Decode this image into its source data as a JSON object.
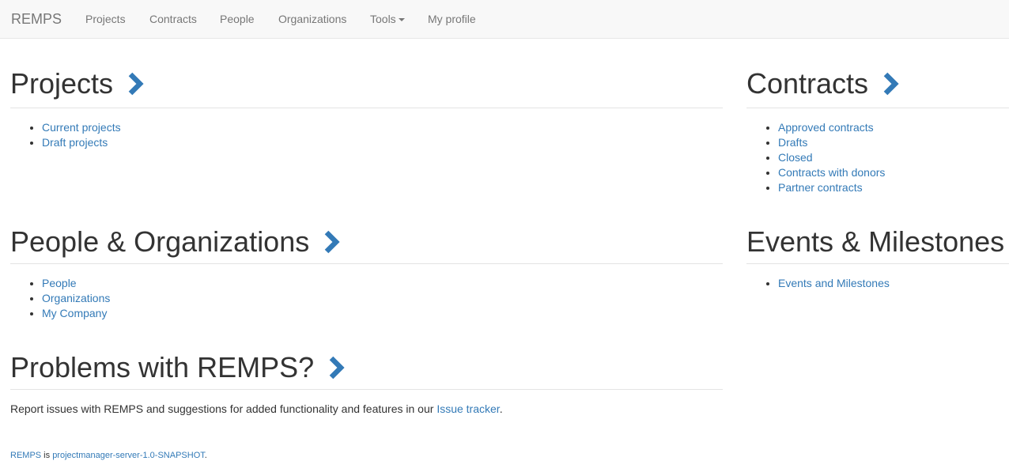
{
  "navbar": {
    "brand": "REMPS",
    "items": [
      {
        "label": "Projects"
      },
      {
        "label": "Contracts"
      },
      {
        "label": "People"
      },
      {
        "label": "Organizations"
      },
      {
        "label": "Tools"
      },
      {
        "label": "My profile"
      }
    ]
  },
  "projects": {
    "title": "Projects",
    "links": [
      "Current projects",
      "Draft projects"
    ]
  },
  "contracts": {
    "title": "Contracts",
    "links": [
      "Approved contracts",
      "Drafts",
      "Closed",
      "Contracts with donors",
      "Partner contracts"
    ]
  },
  "people_orgs": {
    "title": "People & Organizations",
    "links": [
      "People",
      "Organizations",
      "My Company"
    ]
  },
  "events": {
    "title": "Events & Milestones",
    "links": [
      "Events and Milestones"
    ]
  },
  "problems": {
    "title": "Problems with REMPS?",
    "text_before": "Report issues with REMPS and suggestions for added functionality and features in our ",
    "link": "Issue tracker",
    "text_after": "."
  },
  "footer": {
    "app_link": "REMPS",
    "text_mid": " is ",
    "version_link": "projectmanager-server-1.0-SNAPSHOT",
    "text_end": "."
  },
  "colors": {
    "link": "#337ab7",
    "navbar_bg": "#f8f8f8",
    "navbar_text": "#777777",
    "heading": "#333333"
  },
  "icons": {
    "section_arrow": "chevron-right-icon",
    "dropdown": "caret-down-icon"
  }
}
